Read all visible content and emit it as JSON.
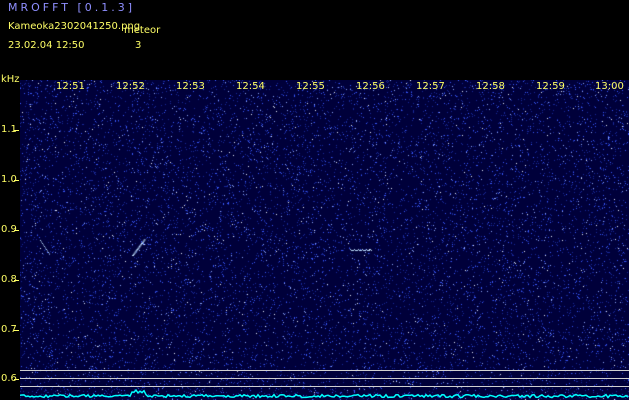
{
  "header": {
    "app_title": "MROFFT [0.1.3]",
    "file_name": "Kameoka2302041250.png",
    "date_time": "23.02.04  12:50",
    "meteor_label": "meteor",
    "meteor_count": "3"
  },
  "spectrogram": {
    "time_ticks": [
      "12:51",
      "12:52",
      "12:53",
      "12:54",
      "12:55",
      "12:56",
      "12:57",
      "12:58",
      "12:59",
      "13:00"
    ],
    "freq_unit": "kHz",
    "freq_ticks": [
      "1.1",
      "1.0",
      "0.9",
      "0.8",
      "0.7",
      "0.6"
    ],
    "colors": {
      "background": "#00003a",
      "noise": "#3a5aff",
      "trace": "#00ffff",
      "labels": "#ffff66"
    }
  }
}
